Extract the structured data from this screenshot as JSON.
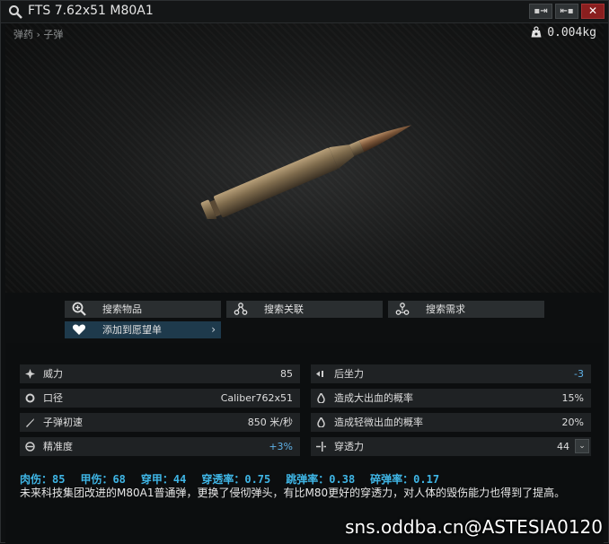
{
  "window": {
    "title": "FTS 7.62x51 M80A1",
    "buttons": {
      "pin": "▪⇥",
      "unpin": "⇤▪",
      "close": "✕"
    }
  },
  "header": {
    "breadcrumb": "弹药 › 子弹",
    "weight": "0.004kg"
  },
  "actions": {
    "search_item": "搜索物品",
    "search_related": "搜索关联",
    "search_needs": "搜索需求",
    "add_wishlist": "添加到愿望单",
    "chevron": "›"
  },
  "stats": {
    "left": [
      {
        "label": "威力",
        "value": "85"
      },
      {
        "label": "口径",
        "value": "Caliber762x51"
      },
      {
        "label": "子弹初速",
        "value": "850 米/秒"
      },
      {
        "label": "精准度",
        "value": "+3%"
      }
    ],
    "right": [
      {
        "label": "后坐力",
        "value": "-3"
      },
      {
        "label": "造成大出血的概率",
        "value": "15%"
      },
      {
        "label": "造成轻微出血的概率",
        "value": "20%"
      },
      {
        "label": "穿透力",
        "value": "44"
      }
    ],
    "dropdown": "⌄"
  },
  "summary": {
    "damage": "肉伤：85",
    "armor_damage": "甲伤：68",
    "penetration": "穿甲：44",
    "pen_rate": "穿透率：0.75",
    "ricochet": "跳弹率：0.38",
    "fragmentation": "碎弹率：0.17"
  },
  "description": "未来科技集团改进的M80A1普通弹，更换了侵彻弹头，有比M80更好的穿透力，对人体的毁伤能力也得到了提高。",
  "watermark": "sns.oddba.cn@ASTESIA0120",
  "colors": {
    "accent": "#3fb6e6",
    "positive": "#5fb2e8",
    "close": "#8a1f1f",
    "wishlist": "#1e3a4c"
  }
}
